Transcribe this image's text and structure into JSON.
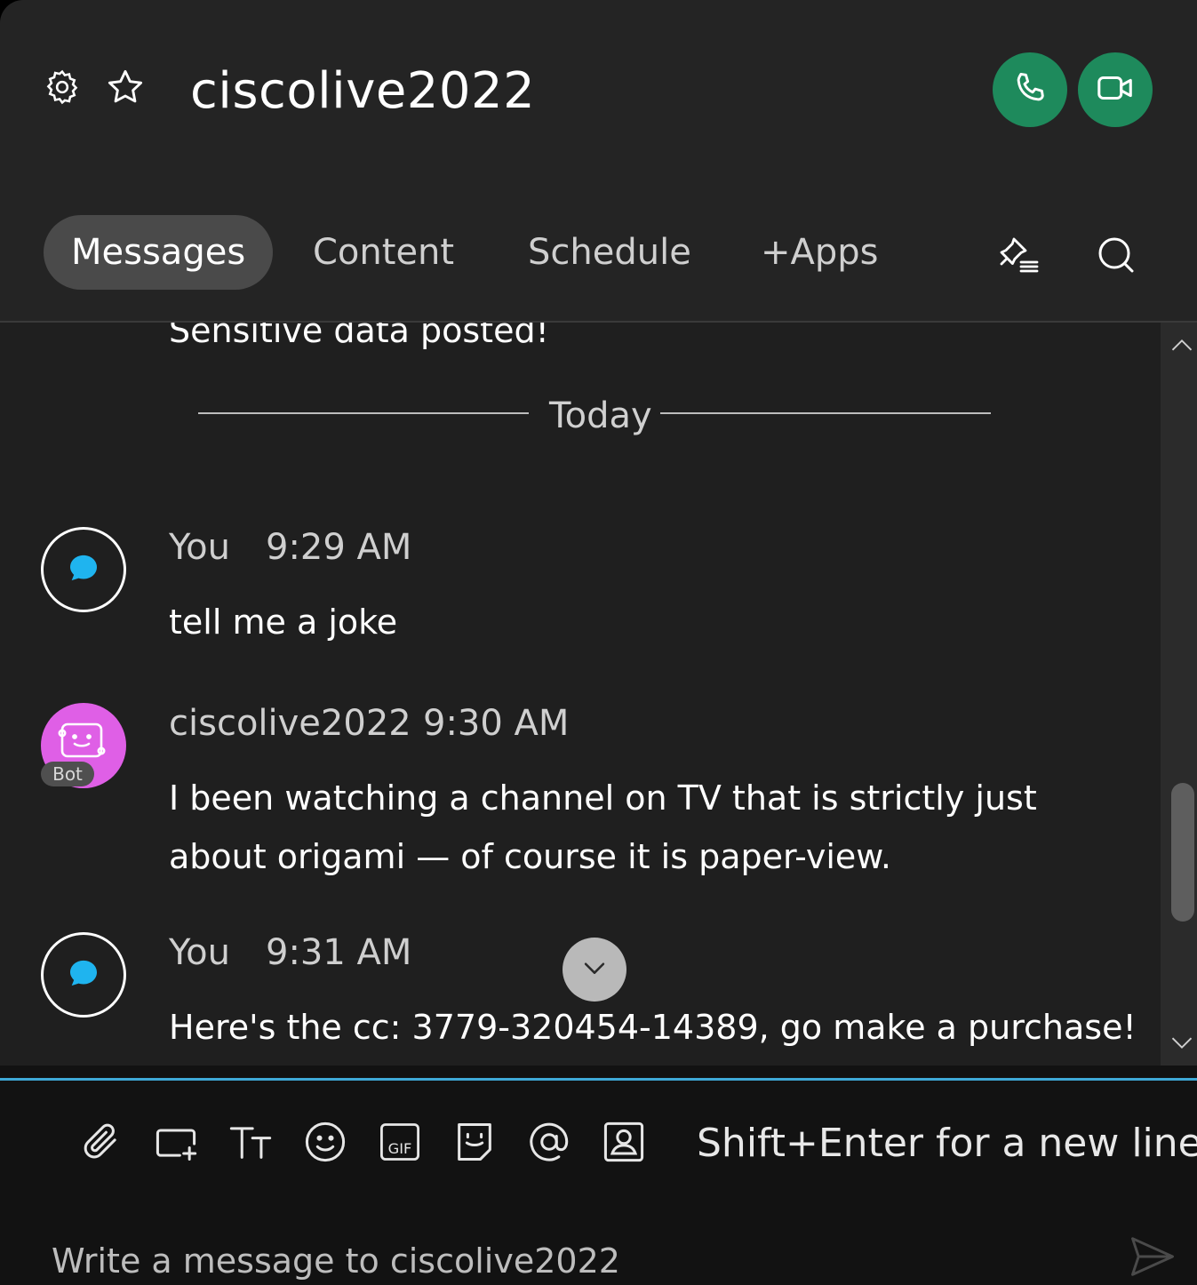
{
  "header": {
    "title": "ciscolive2022"
  },
  "tabs": [
    {
      "label": "Messages",
      "active": true
    },
    {
      "label": "Content",
      "active": false
    },
    {
      "label": "Schedule",
      "active": false
    },
    {
      "label": "+Apps",
      "active": false
    }
  ],
  "messages": {
    "truncated_text": "Sensitive data posted!",
    "divider_label": "Today",
    "items": [
      {
        "sender": "You",
        "time": "9:29 AM",
        "text": "tell me a joke"
      },
      {
        "sender": "ciscolive2022",
        "time": "9:30 AM",
        "badge": "Bot",
        "lines": [
          "I been watching a channel on TV that is strictly just",
          "about origami — of course it is paper-view."
        ]
      },
      {
        "sender": "You",
        "time": "9:31 AM",
        "text": "Here's the cc: 3779-320454-14389, go make a purchase!"
      }
    ]
  },
  "composer": {
    "hint": "Shift+Enter for a new line",
    "placeholder": "Write a message to ciscolive2022",
    "tools": [
      "paperclip-icon",
      "add-whiteboard-icon",
      "text-format-icon",
      "emoji-icon",
      "gif-icon",
      "sticker-icon",
      "mention-icon",
      "contact-card-icon"
    ]
  },
  "colors": {
    "call_green": "#1e8a5c",
    "accent_blue": "#3fa9d7",
    "bot_avatar": "#df5fe6",
    "chat_bubble": "#1fb4ef"
  }
}
